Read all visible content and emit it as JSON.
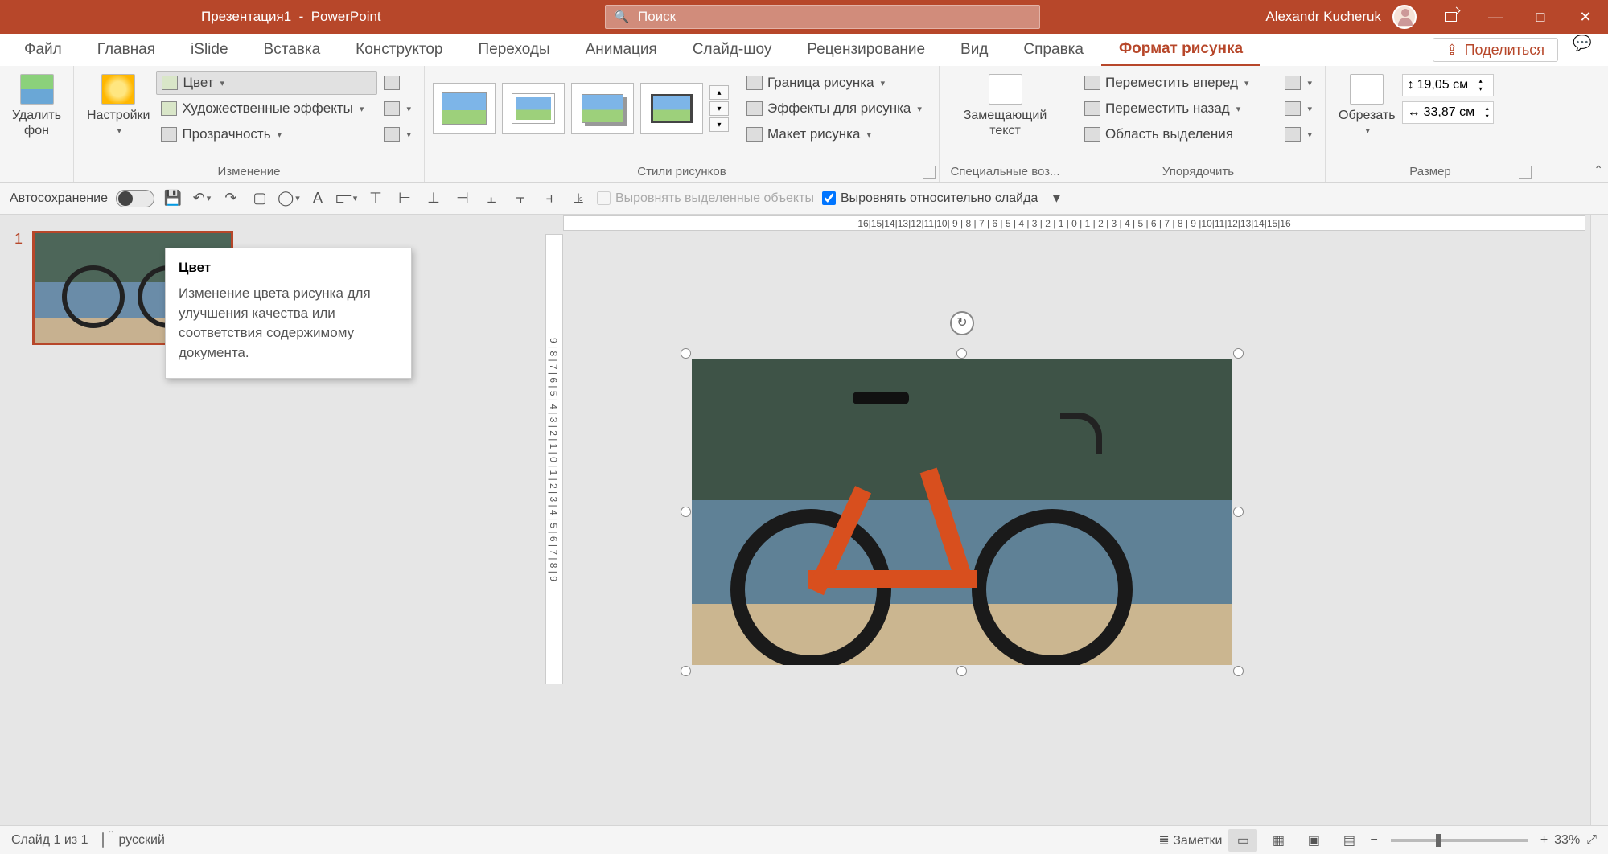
{
  "title": {
    "document": "Презентация1",
    "app": "PowerPoint"
  },
  "search": {
    "placeholder": "Поиск"
  },
  "user": {
    "name": "Alexandr Kucheruk"
  },
  "tabs": {
    "file": "Файл",
    "home": "Главная",
    "islide": "iSlide",
    "insert": "Вставка",
    "design": "Конструктор",
    "transitions": "Переходы",
    "animations": "Анимация",
    "slideshow": "Слайд-шоу",
    "review": "Рецензирование",
    "view": "Вид",
    "help": "Справка",
    "picture_format": "Формат рисунка"
  },
  "share": "Поделиться",
  "ribbon": {
    "remove_bg": "Удалить\nфон",
    "corrections": "Настройки",
    "color": "Цвет",
    "art_effects": "Художественные эффекты",
    "transparency": "Прозрачность",
    "group_adjust": "Изменение",
    "group_styles": "Стили рисунков",
    "border": "Граница рисунка",
    "effects": "Эффекты для рисунка",
    "layout": "Макет рисунка",
    "alt_text": "Замещающий\nтекст",
    "group_acc": "Специальные воз...",
    "bring_fwd": "Переместить вперед",
    "send_back": "Переместить назад",
    "selection_pane": "Область выделения",
    "group_arrange": "Упорядочить",
    "crop": "Обрезать",
    "group_size": "Размер",
    "height": "19,05 см",
    "width": "33,87 см"
  },
  "qat": {
    "autosave": "Автосохранение",
    "align_selected": "Выровнять выделенные объекты",
    "align_slide": "Выровнять относительно слайда"
  },
  "tooltip": {
    "title": "Цвет",
    "body": "Изменение цвета рисунка для улучшения качества или соответствия содержимому документа."
  },
  "ruler_h": "16|15|14|13|12|11|10| 9 | 8 | 7 | 6 | 5 | 4 | 3 | 2 | 1 | 0 | 1 | 2 | 3 | 4 | 5 | 6 | 7 | 8 | 9 |10|11|12|13|14|15|16",
  "ruler_v": "9 | 8 | 7 | 6 | 5 | 4 | 3 | 2 | 1 | 0 | 1 | 2 | 3 | 4 | 5 | 6 | 7 | 8 | 9",
  "slide_number": "1",
  "status": {
    "slide_of": "Слайд 1 из 1",
    "language": "русский",
    "notes": "Заметки",
    "zoom": "33%"
  }
}
